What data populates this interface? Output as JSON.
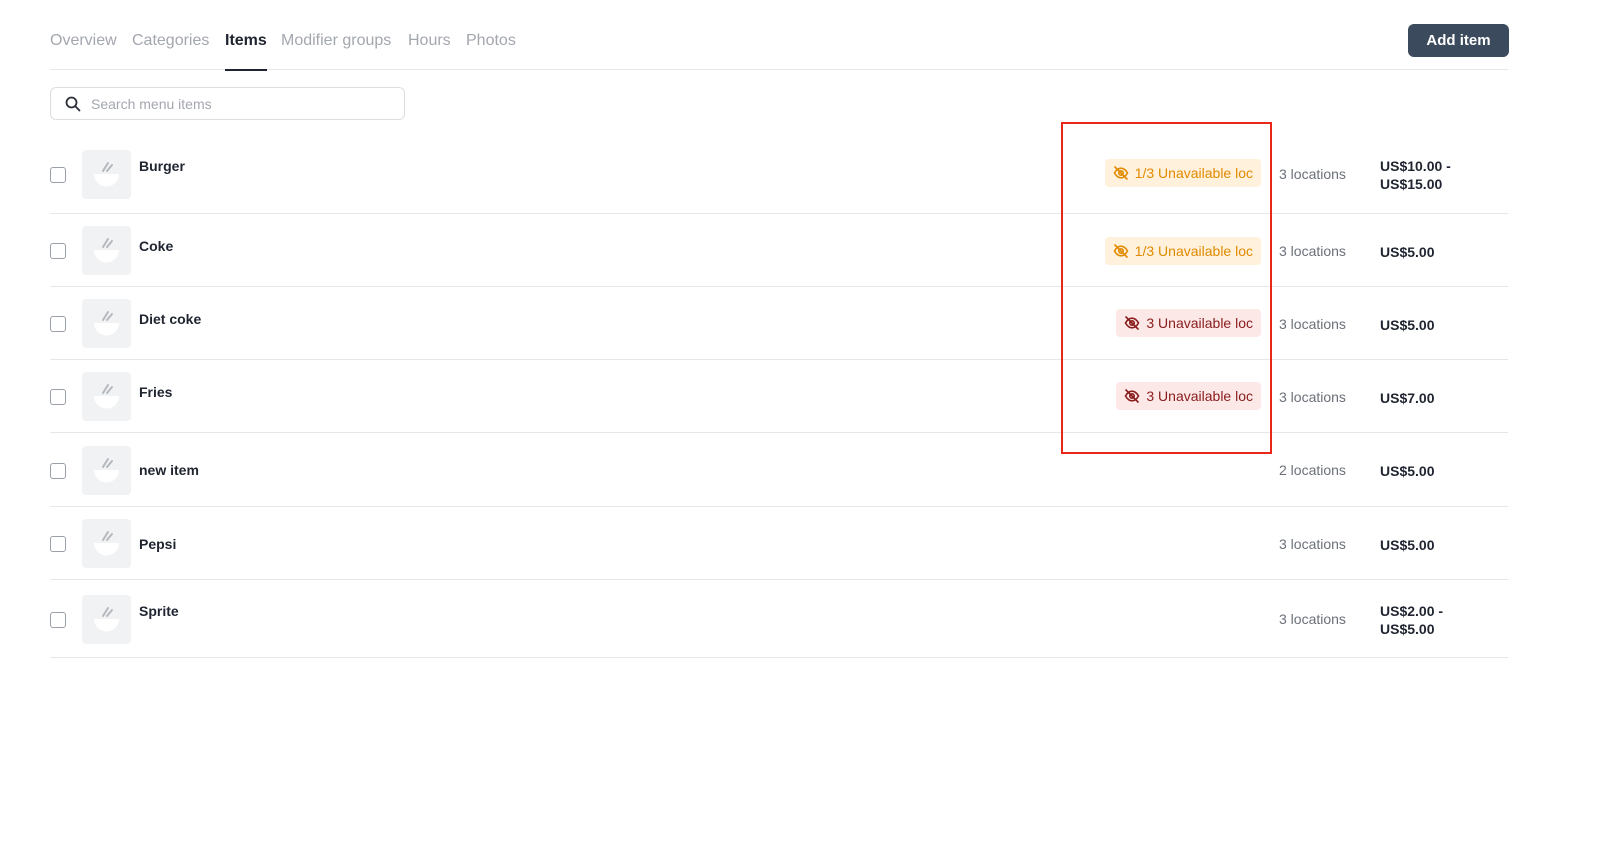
{
  "tabs": [
    {
      "label": "Overview",
      "active": false
    },
    {
      "label": "Categories",
      "active": false
    },
    {
      "label": "Items",
      "active": true
    },
    {
      "label": "Modifier groups",
      "active": false
    },
    {
      "label": "Hours",
      "active": false
    },
    {
      "label": "Photos",
      "active": false
    }
  ],
  "header": {
    "add_item_label": "Add item"
  },
  "search": {
    "placeholder": "Search menu items",
    "value": ""
  },
  "items": [
    {
      "name": "Burger",
      "badge": "1/3 Unavailable loc",
      "badge_type": "partial",
      "locations": "3 locations",
      "price_line1": "US$10.00 -",
      "price_line2": "US$15.00"
    },
    {
      "name": "Coke",
      "badge": "1/3 Unavailable loc",
      "badge_type": "partial",
      "locations": "3 locations",
      "price_line1": "US$5.00",
      "price_line2": ""
    },
    {
      "name": "Diet coke",
      "badge": "3 Unavailable loc",
      "badge_type": "full",
      "locations": "3 locations",
      "price_line1": "US$5.00",
      "price_line2": ""
    },
    {
      "name": "Fries",
      "badge": "3 Unavailable loc",
      "badge_type": "full",
      "locations": "3 locations",
      "price_line1": "US$7.00",
      "price_line2": ""
    },
    {
      "name": "new item",
      "badge": "",
      "badge_type": "",
      "locations": "2 locations",
      "price_line1": "US$5.00",
      "price_line2": ""
    },
    {
      "name": "Pepsi",
      "badge": "",
      "badge_type": "",
      "locations": "3 locations",
      "price_line1": "US$5.00",
      "price_line2": ""
    },
    {
      "name": "Sprite",
      "badge": "",
      "badge_type": "",
      "locations": "3 locations",
      "price_line1": "US$2.00 -",
      "price_line2": "US$5.00"
    }
  ],
  "colors": {
    "accent_button": "#3b4a5c",
    "partial_badge_bg": "#fff1dc",
    "partial_badge_text": "#e28a00",
    "full_badge_bg": "#fde8e8",
    "full_badge_text": "#8a1c1c",
    "highlight_box": "#e8261a"
  },
  "icons": {
    "search": "search-icon",
    "item_placeholder": "bowl-chopsticks-icon",
    "unavailable": "eye-off-icon"
  }
}
